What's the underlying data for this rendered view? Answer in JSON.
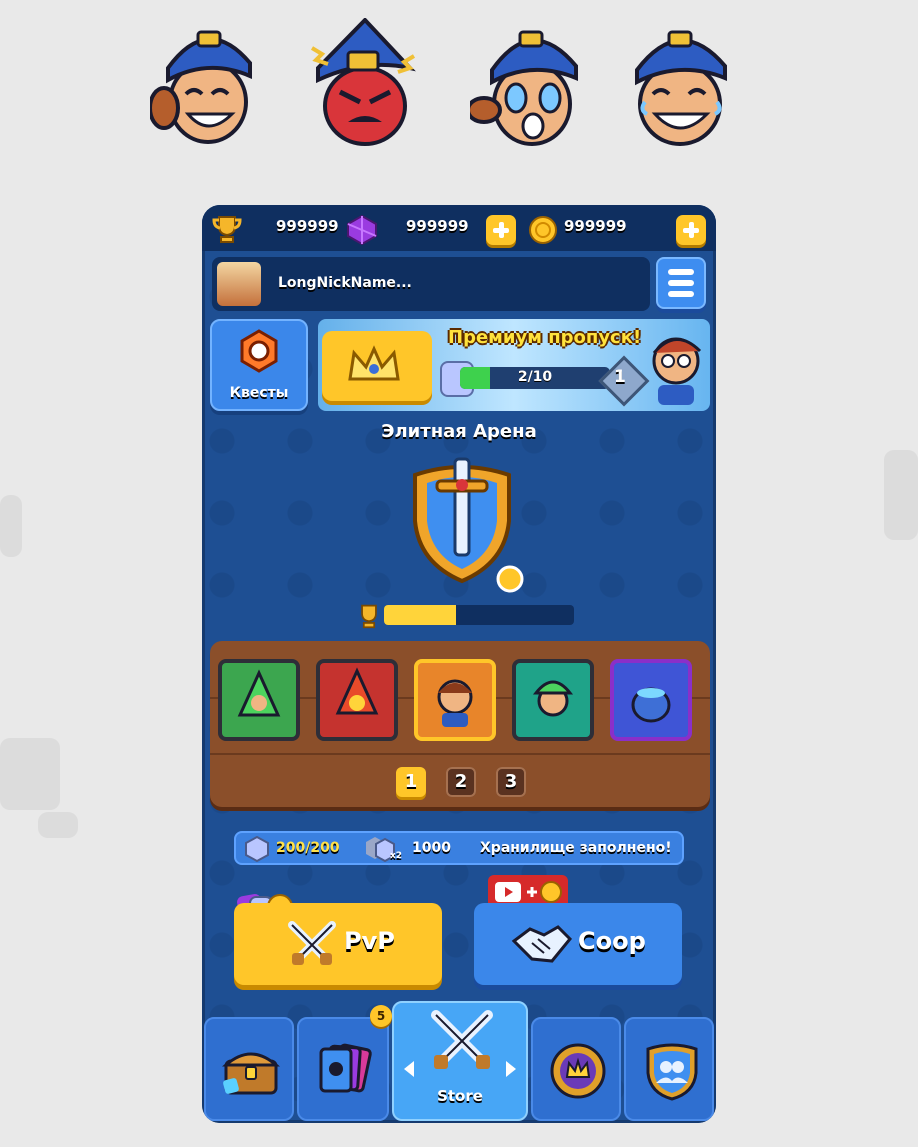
{
  "emotes": [
    "thumbs-up-laugh-emote",
    "angry-emote",
    "crying-emote",
    "laughing-emote"
  ],
  "topbar": {
    "trophies": "999999",
    "gems": "999999",
    "coins": "999999"
  },
  "profile": {
    "nickname": "LongNickName..."
  },
  "quests": {
    "label": "Квесты"
  },
  "premium_pass": {
    "title": "Премиум пропуск!",
    "progress_text": "2/10",
    "progress": 0.2,
    "level": "1"
  },
  "arena": {
    "title": "Элитная Арена",
    "trophy_progress": 0.38
  },
  "deck": {
    "pages": [
      "1",
      "2",
      "3"
    ],
    "active_page": "1",
    "cards": [
      "green-hood-unit-icon",
      "fire-mage-icon",
      "hero-portrait-icon",
      "green-knight-icon",
      "cauldron-icon"
    ]
  },
  "storage": {
    "amount": "200/200",
    "multiplier": "x2",
    "bonus": "1000",
    "status": "Хранилище заполнено!"
  },
  "modes": {
    "pvp": "PvP",
    "coop": "Coop"
  },
  "nav": {
    "store_label": "Store",
    "cards_badge": "5"
  },
  "colors": {
    "accent": "#ffc629",
    "panel": "#1e4f93",
    "button_blue": "#3b87ea"
  }
}
